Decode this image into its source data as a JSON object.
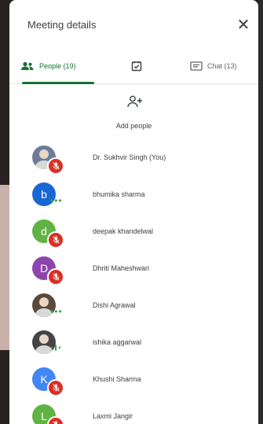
{
  "panel": {
    "title": "Meeting details"
  },
  "tabs": [
    {
      "label": "People (19)",
      "icon": "people-icon",
      "active": true,
      "color": "#137333"
    },
    {
      "label": "",
      "icon": "meeting-info-icon",
      "active": false
    },
    {
      "label": "Chat (13)",
      "icon": "chat-icon",
      "active": false
    }
  ],
  "add_people": {
    "label": "Add people",
    "icon": "add-person-icon"
  },
  "participants": [
    {
      "name": "Dr. Sukhvir Singh (You)",
      "avatar_letter": "",
      "avatar_color": "#6d7b9b",
      "status": "muted"
    },
    {
      "name": "bhumika sharma",
      "avatar_letter": "b",
      "avatar_color": "#1967d2",
      "status": "more"
    },
    {
      "name": "deepak khandelwal",
      "avatar_letter": "d",
      "avatar_color": "#5fb342",
      "status": "muted"
    },
    {
      "name": "Dhriti Maheshwari",
      "avatar_letter": "D",
      "avatar_color": "#8e44ad",
      "status": "muted"
    },
    {
      "name": "Dishi Agrawal",
      "avatar_letter": "",
      "avatar_color": "#5b4a3a",
      "status": "more"
    },
    {
      "name": "ishika aggarwal",
      "avatar_letter": "",
      "avatar_color": "#444444",
      "status": "speaking"
    },
    {
      "name": "Khushi Sharma",
      "avatar_letter": "K",
      "avatar_color": "#4285f4",
      "status": "muted"
    },
    {
      "name": "Laxmi Jangir",
      "avatar_letter": "L",
      "avatar_color": "#5fb342",
      "status": "muted"
    }
  ]
}
